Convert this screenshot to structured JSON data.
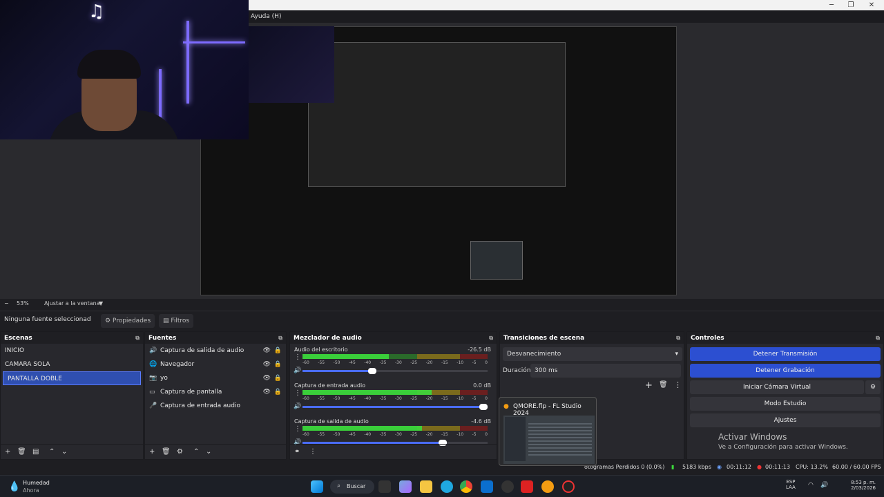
{
  "window": {
    "menu_item": "Ayuda (H)",
    "min": "─",
    "max": "❐",
    "close": "✕"
  },
  "preview": {
    "zoom_minus": "−",
    "zoom": "53%",
    "fit": "Ajustar a la ventana"
  },
  "source_bar": {
    "selected": "Ninguna fuente seleccionad",
    "properties": "Propiedades",
    "filters": "Filtros"
  },
  "scenes": {
    "title": "Escenas",
    "items": [
      "INICIO",
      "CAMARA SOLA",
      "PANTALLA DOBLE"
    ],
    "selected_index": 2
  },
  "sources": {
    "title": "Fuentes",
    "items": [
      {
        "label": "Captura de salida de audio",
        "icon": "speaker-icon"
      },
      {
        "label": "Navegador",
        "icon": "globe-icon"
      },
      {
        "label": "yo",
        "icon": "camera-icon"
      },
      {
        "label": "Captura de pantalla",
        "icon": "monitor-icon"
      },
      {
        "label": "Captura de entrada audio",
        "icon": "mic-icon"
      }
    ]
  },
  "mixer": {
    "title": "Mezclador de audio",
    "ticks": [
      "-60",
      "-55",
      "-50",
      "-45",
      "-40",
      "-35",
      "-30",
      "-25",
      "-20",
      "-15",
      "-10",
      "-5",
      "0"
    ],
    "channels": [
      {
        "name": "Audio del escritorio",
        "db": "-26.5 dB",
        "level": 0.55,
        "volume": 0.4
      },
      {
        "name": "Captura de entrada audio",
        "db": "0.0 dB",
        "level": 0.82,
        "volume": 1.0
      },
      {
        "name": "Captura de salida de audio",
        "db": "-4.6 dB",
        "level": 0.76,
        "volume": 0.78
      }
    ]
  },
  "transitions": {
    "title": "Transiciones de escena",
    "type": "Desvanecimiento",
    "duration_label": "Duración",
    "duration": "300 ms"
  },
  "controls": {
    "title": "Controles",
    "stop_stream": "Detener Transmisión",
    "stop_record": "Detener Grabación",
    "virtual_cam": "Iniciar Cámara Virtual",
    "studio": "Modo Estudio",
    "settings": "Ajustes"
  },
  "activate": {
    "title": "Activar Windows",
    "sub": "Ve a Configuración para activar Windows."
  },
  "thumbnail": {
    "title": "QMORE.flp - FL Studio 2024"
  },
  "status": {
    "dropped": "otogramas Perdidos 0 (0.0%)",
    "kbps": "5183 kbps",
    "stream_time": "00:11:12",
    "rec_time": "00:11:13",
    "cpu": "CPU: 13.2%",
    "fps": "60.00 / 60.00 FPS"
  },
  "taskbar": {
    "weather_title": "Humedad",
    "weather_sub": "Ahora",
    "search": "Buscar",
    "lang1": "ESP",
    "lang2": "LAA",
    "time": "8:53 p. m.",
    "date": "2/03/2026"
  },
  "colors": {
    "accent": "#2c4fd1",
    "dock_bg": "#28282d",
    "panel_bg": "#1e1e22"
  }
}
